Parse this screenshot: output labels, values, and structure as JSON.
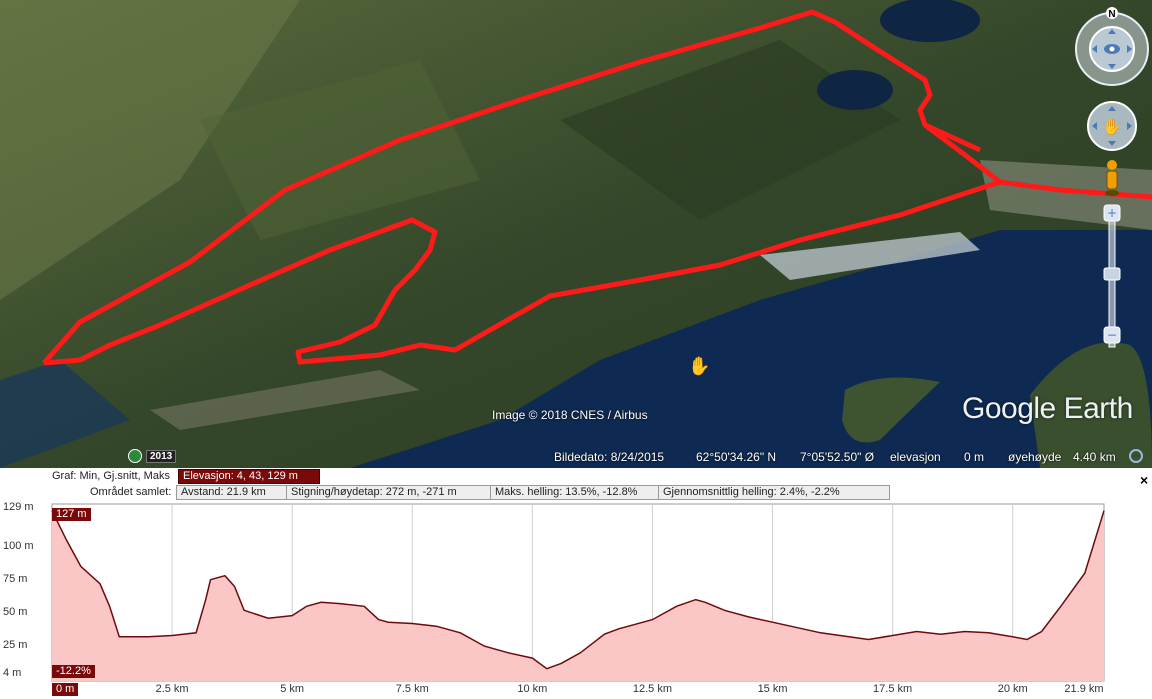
{
  "map": {
    "credit": "Image © 2018 CNES / Airbus",
    "logo": "Google Earth",
    "year": "2013",
    "colors": {
      "route": "#ff1a1a",
      "water": "#0e2a52",
      "land": "#3f5532"
    }
  },
  "status": {
    "date_label": "Bildedato: 8/24/2015",
    "lat": "62°50'34.26\" N",
    "lon": "7°05'52.50\" Ø",
    "elev_label": "elevasjon",
    "elev_value": "0 m",
    "eye_label": "øyehøyde",
    "eye_value": "4.40 km"
  },
  "nav": {
    "north": "N",
    "icons": [
      "look-joystick-icon",
      "move-joystick-icon",
      "streetview-pegman-icon",
      "zoom-in-icon",
      "zoom-out-icon"
    ]
  },
  "profile": {
    "graph_label": "Graf: Min, Gj.snitt, Maks",
    "elevation_box": "Elevasjon: 4, 43, 129 m",
    "area_label": "Området samlet:",
    "distance_box": "Avstand: 21.9 km",
    "climb_box": "Stigning/høydetap: 272 m, -271 m",
    "slope_box": "Maks. helling: 13.5%, -12.8%",
    "avg_slope_box": "Gjennomsnittlig helling: 2.4%, -2.2%",
    "close": "×",
    "tag_top": "127 m",
    "tag_bottom": "-12.2%",
    "tag_left": "0 m"
  },
  "chart_data": {
    "type": "area",
    "ylabel_ticks": [
      "129 m",
      "100 m",
      "75 m",
      "50 m",
      "25 m",
      "4 m"
    ],
    "y_tick_values": [
      129,
      100,
      75,
      50,
      25,
      4
    ],
    "x_ticks": [
      "0 m",
      "2.5 km",
      "5 km",
      "7.5 km",
      "10 km",
      "12.5 km",
      "15 km",
      "17.5 km",
      "20 km",
      "21.9 km"
    ],
    "x_tick_values": [
      0,
      2.5,
      5,
      7.5,
      10,
      12.5,
      15,
      17.5,
      20,
      21.9
    ],
    "ylim": [
      4,
      129
    ],
    "xlim": [
      0,
      21.9
    ],
    "series": [
      {
        "x": [
          0,
          0.3,
          0.6,
          1.0,
          1.2,
          1.4,
          2.0,
          2.5,
          3.0,
          3.2,
          3.3,
          3.6,
          3.8,
          4.0,
          4.5,
          5.0,
          5.3,
          5.6,
          6.0,
          6.5,
          6.8,
          7.0,
          7.5,
          8.0,
          8.5,
          9.0,
          9.5,
          10.0,
          10.3,
          10.6,
          11.0,
          11.5,
          11.8,
          12.5,
          13.0,
          13.4,
          13.6,
          14.0,
          14.5,
          15.0,
          16.0,
          17.0,
          17.5,
          18.0,
          18.5,
          19.0,
          19.5,
          20.0,
          20.3,
          20.6,
          21.0,
          21.5,
          21.9
        ],
        "y": [
          127,
          105,
          85,
          72,
          55,
          32,
          32,
          33,
          35,
          60,
          75,
          78,
          70,
          52,
          46,
          48,
          55,
          58,
          57,
          55,
          45,
          43,
          42,
          40,
          35,
          25,
          20,
          16,
          8,
          12,
          20,
          34,
          38,
          45,
          55,
          60,
          58,
          52,
          47,
          43,
          35,
          30,
          33,
          36,
          34,
          36,
          35,
          32,
          30,
          36,
          55,
          80,
          127
        ]
      }
    ]
  }
}
